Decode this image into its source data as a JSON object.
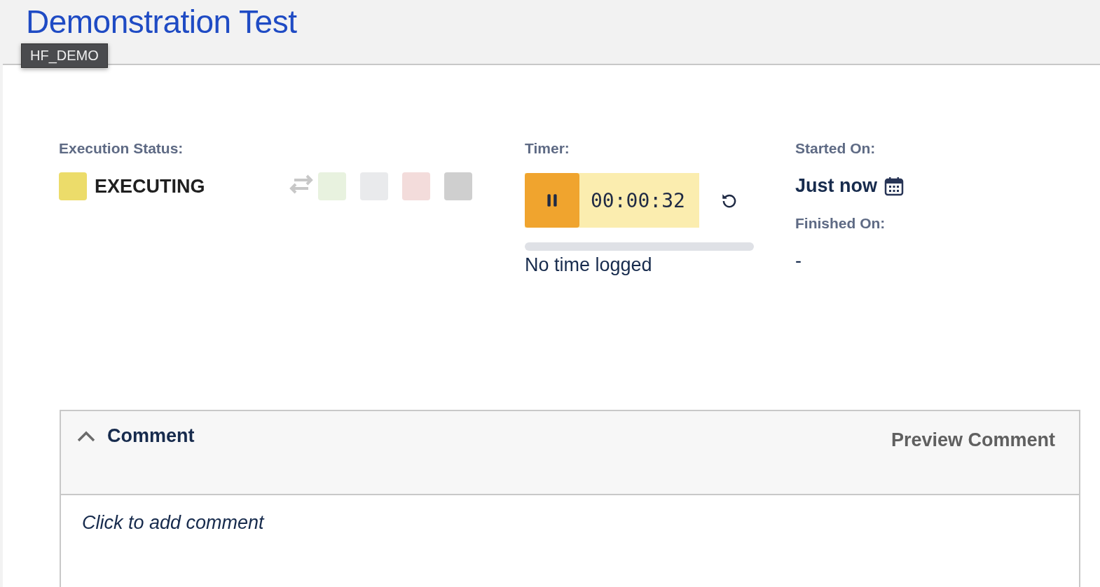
{
  "header": {
    "title": "Demonstration Test",
    "tooltip": "HF_DEMO"
  },
  "execution_status": {
    "label": "Execution Status:",
    "current": {
      "name": "EXECUTING",
      "color": "#ecdc6a"
    },
    "quick_statuses": [
      {
        "color": "#e8f2df"
      },
      {
        "color": "#e9eaec"
      },
      {
        "color": "#f3dcdb"
      },
      {
        "color": "#cfcfcf"
      }
    ]
  },
  "timer": {
    "label": "Timer:",
    "running": true,
    "time": "00:00:32",
    "level": 0,
    "logged": "No time logged"
  },
  "started_on": {
    "label": "Started On:",
    "value": "Just now"
  },
  "finished_on": {
    "label": "Finished On:",
    "value": "-"
  },
  "comment": {
    "title": "Comment",
    "expanded": true,
    "preview": "Preview Comment",
    "placeholder": "Click to add comment"
  }
}
